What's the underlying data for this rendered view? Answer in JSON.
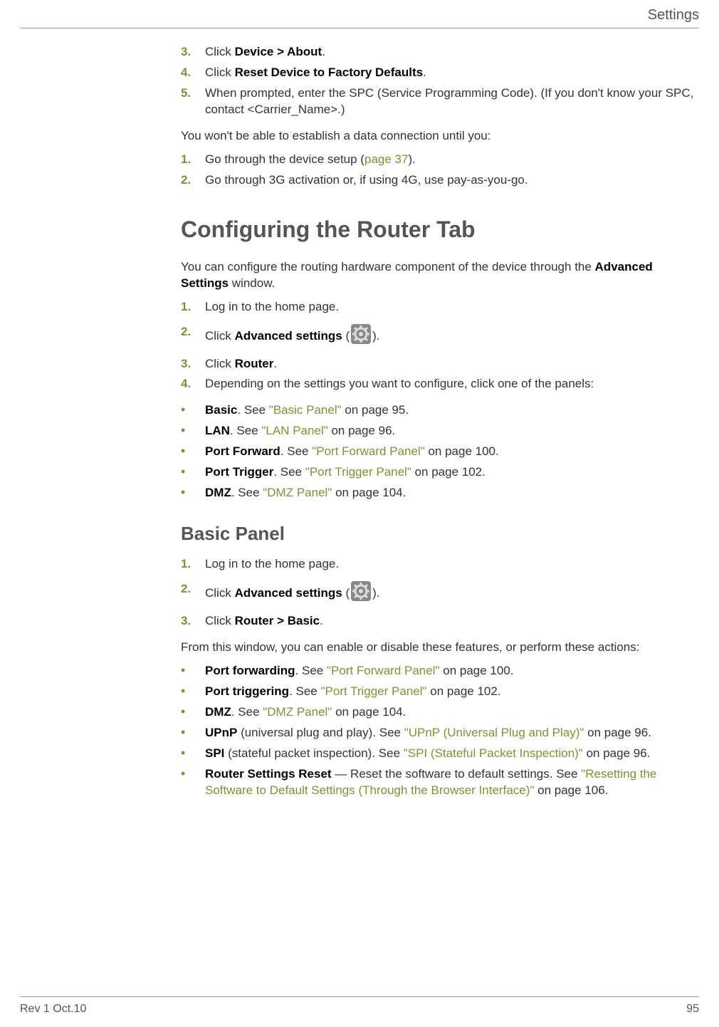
{
  "header": {
    "title": "Settings"
  },
  "section1": {
    "steps_a": [
      {
        "num": "3.",
        "pre": "Click ",
        "bold": "Device > About",
        "post": "."
      },
      {
        "num": "4.",
        "pre": "Click ",
        "bold": "Reset Device to Factory Defaults",
        "post": "."
      },
      {
        "num": "5.",
        "pre": "",
        "bold": "",
        "post": "When prompted, enter the SPC (Service Programming Code). (If you don't know your SPC, contact <Carrier_Name>.)"
      }
    ],
    "lead_b": "You won't be able to establish a data connection until you:",
    "steps_b": [
      {
        "num": "1.",
        "pre": "Go through the device setup (",
        "link": "page 37",
        "post": ")."
      },
      {
        "num": "2.",
        "text": "Go through 3G activation or, if using 4G, use pay-as-you-go."
      }
    ]
  },
  "section2": {
    "heading": "Configuring the Router Tab",
    "intro_pre": "You can configure the routing hardware component of the device through the ",
    "intro_bold": "Advanced Settings",
    "intro_post": " window.",
    "steps": [
      {
        "num": "1.",
        "text": "Log in to the home page."
      },
      {
        "num": "2.",
        "pre": "Click ",
        "bold": "Advanced settings",
        "post1": " (",
        "post2": ")."
      },
      {
        "num": "3.",
        "pre": "Click ",
        "bold": "Router",
        "post": "."
      },
      {
        "num": "4.",
        "text": "Depending on the settings you want to configure, click one of the panels:"
      }
    ],
    "bullets": [
      {
        "bold": "Basic",
        "mid": ". See ",
        "link": "\"Basic Panel\"",
        "post": " on page 95."
      },
      {
        "bold": "LAN",
        "mid": ". See ",
        "link": "\"LAN Panel\"",
        "post": " on page 96."
      },
      {
        "bold": "Port Forward",
        "mid": ". See ",
        "link": "\"Port Forward Panel\"",
        "post": " on page 100."
      },
      {
        "bold": "Port Trigger",
        "mid": ". See ",
        "link": "\"Port Trigger Panel\"",
        "post": " on page 102."
      },
      {
        "bold": "DMZ",
        "mid": ". See ",
        "link": "\"DMZ Panel\"",
        "post": " on page 104."
      }
    ]
  },
  "section3": {
    "heading": "Basic Panel",
    "steps": [
      {
        "num": "1.",
        "text": "Log in to the home page."
      },
      {
        "num": "2.",
        "pre": "Click ",
        "bold": "Advanced settings",
        "post1": " (",
        "post2": ")."
      },
      {
        "num": "3.",
        "pre": "Click ",
        "bold": "Router > Basic",
        "post": "."
      }
    ],
    "lead": "From this window, you can enable or disable these features, or perform these actions:",
    "bullets": [
      {
        "bold": "Port forwarding",
        "mid": ". See ",
        "link": "\"Port Forward Panel\"",
        "post": " on page 100."
      },
      {
        "bold": "Port triggering",
        "mid": ". See ",
        "link": "\"Port Trigger Panel\"",
        "post": " on page 102."
      },
      {
        "bold": "DMZ",
        "mid": ". See ",
        "link": "\"DMZ Panel\"",
        "post": " on page 104."
      },
      {
        "bold": "UPnP",
        "mid": " (universal plug and play). See ",
        "link": "\"UPnP (Universal Plug and Play)\"",
        "post": " on page 96."
      },
      {
        "bold": "SPI",
        "mid": " (stateful packet inspection). See ",
        "link": "\"SPI (Stateful Packet Inspection)\"",
        "post": " on page 96."
      },
      {
        "bold": "Router Settings Reset",
        "mid": " — Reset the software to default settings. See ",
        "link": "\"Resetting the Software to Default Settings (Through the Browser Interface)\"",
        "post": " on page 106."
      }
    ]
  },
  "footer": {
    "left": "Rev 1  Oct.10",
    "right": "95"
  }
}
